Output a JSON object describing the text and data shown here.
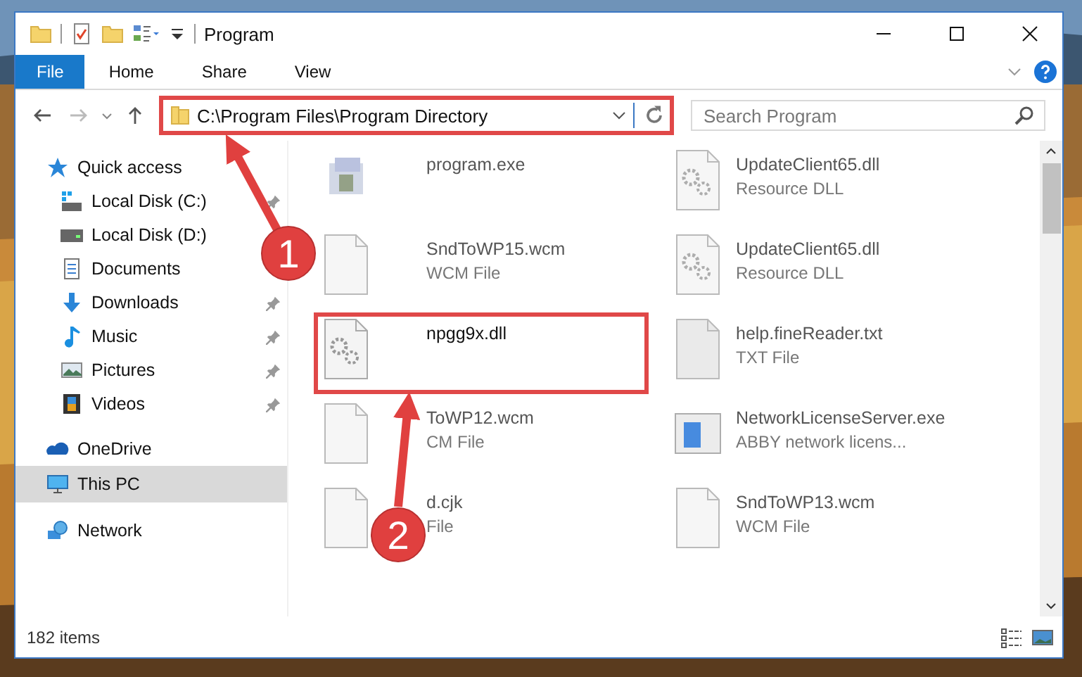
{
  "window": {
    "title": "Program"
  },
  "ribbon": {
    "tabs": [
      {
        "label": "File",
        "selected": true
      },
      {
        "label": "Home",
        "selected": false
      },
      {
        "label": "Share",
        "selected": false
      },
      {
        "label": "View",
        "selected": false
      }
    ]
  },
  "address": {
    "path": "C:\\Program Files\\Program Directory",
    "highlighted": true
  },
  "search": {
    "placeholder": "Search Program"
  },
  "sidebar": {
    "items": [
      {
        "label": "Quick access",
        "kind": "star",
        "selected": false,
        "children": [
          {
            "label": "Local Disk (C:)",
            "kind": "drive-win",
            "pinned": true
          },
          {
            "label": "Local Disk (D:)",
            "kind": "drive"
          },
          {
            "label": "Documents",
            "kind": "documents"
          },
          {
            "label": "Downloads",
            "kind": "download",
            "pinned": true
          },
          {
            "label": "Music",
            "kind": "music",
            "pinned": true
          },
          {
            "label": "Pictures",
            "kind": "pictures",
            "pinned": true
          },
          {
            "label": "Videos",
            "kind": "videos",
            "pinned": true
          }
        ]
      },
      {
        "label": "OneDrive",
        "kind": "cloud",
        "selected": false
      },
      {
        "label": "This PC",
        "kind": "pc",
        "selected": true
      },
      {
        "label": "Network",
        "kind": "network",
        "selected": false
      }
    ]
  },
  "files": [
    {
      "name": "program.exe",
      "kind": "exe",
      "blurred": true,
      "highlighted": false
    },
    {
      "name": "UpdateClient65.dll",
      "type": "Resource DLL",
      "kind": "dll",
      "blurred": true,
      "highlighted": false
    },
    {
      "name": "SndToWP15.wcm",
      "type": "WCM File",
      "kind": "blank",
      "blurred": true,
      "highlighted": false
    },
    {
      "name": "UpdateClient65.dll",
      "type": "Resource DLL",
      "kind": "dll",
      "blurred": true,
      "highlighted": false
    },
    {
      "name": "npgg9x.dll",
      "kind": "gears",
      "blurred": false,
      "highlighted": true
    },
    {
      "name": "help.fineReader.txt",
      "type": "TXT File",
      "kind": "txt",
      "blurred": true,
      "highlighted": false
    },
    {
      "name": "ToWP12.wcm",
      "type": "CM File",
      "kind": "blank",
      "blurred": true,
      "highlighted": false
    },
    {
      "name": "NetworkLicenseServer.exe",
      "type": "ABBY network licens...",
      "kind": "app",
      "blurred": true,
      "highlighted": false
    },
    {
      "name": "d.cjk",
      "type": "File",
      "kind": "blank",
      "blurred": true,
      "highlighted": false
    },
    {
      "name": "SndToWP13.wcm",
      "type": "WCM File",
      "kind": "blank",
      "blurred": true,
      "highlighted": false
    }
  ],
  "status_bar": {
    "count": "182 items"
  },
  "annotations": [
    {
      "number": "1"
    },
    {
      "number": "2"
    }
  ]
}
